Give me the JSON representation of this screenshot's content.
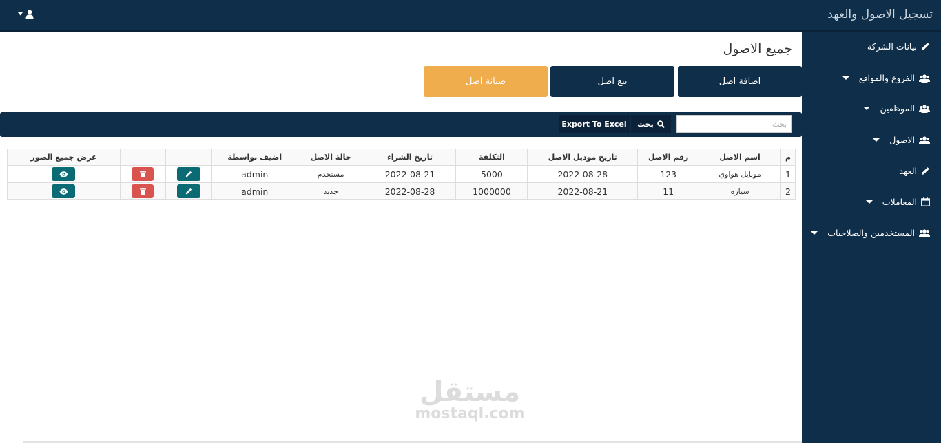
{
  "header": {
    "app_title": "تسجيل الاصول والعهد",
    "user_icon": "user-icon"
  },
  "sidebar": {
    "items": [
      {
        "label": "بيانات الشركة",
        "icon": "pencil-icon",
        "has_caret": false
      },
      {
        "label": "الفروع والمواقع",
        "icon": "users-icon",
        "has_caret": true
      },
      {
        "label": "الموظفين",
        "icon": "users-icon",
        "has_caret": true
      },
      {
        "label": "الاصول",
        "icon": "users-icon",
        "has_caret": true
      },
      {
        "label": "العهد",
        "icon": "pencil-icon",
        "has_caret": false
      },
      {
        "label": "المعاملات",
        "icon": "calendar-icon",
        "has_caret": true
      },
      {
        "label": "المستخدمين والصلاحيات",
        "icon": "users-icon",
        "has_caret": true
      }
    ]
  },
  "main": {
    "page_title": "جميع الاصول",
    "actions": {
      "add_asset": "اضافة اصل",
      "sell_asset": "بيع اصل",
      "maintain_asset": "صيانة اصل"
    },
    "toolbar": {
      "search_placeholder": "بحث",
      "search_button": "بحث",
      "export_button": "Export To Excel"
    },
    "table": {
      "headers": [
        "م",
        "اسم الاصل",
        "رقم الاصل",
        "تاريخ موديل الاصل",
        "التكلفة",
        "تاريخ الشراء",
        "حالة الاصل",
        "اضيف بواسطة",
        "",
        "",
        "عرض جميع الصور"
      ],
      "rows": [
        {
          "index": "1",
          "name": "موبايل هواوي",
          "number": "123",
          "model_date": "2022-08-28",
          "cost": "5000",
          "purchase_date": "2022-08-21",
          "status": "مستخدم",
          "added_by": "admin"
        },
        {
          "index": "2",
          "name": "سياره",
          "number": "11",
          "model_date": "2022-08-21",
          "cost": "1000000",
          "purchase_date": "2022-08-28",
          "status": "جديد",
          "added_by": "admin"
        }
      ]
    }
  },
  "watermark": {
    "arabic": "مستقل",
    "latin": "mostaql.com"
  },
  "colors": {
    "navy": "#0f2e49",
    "orange": "#f0ad4e",
    "teal": "#0b6b74",
    "red": "#d9534f"
  }
}
